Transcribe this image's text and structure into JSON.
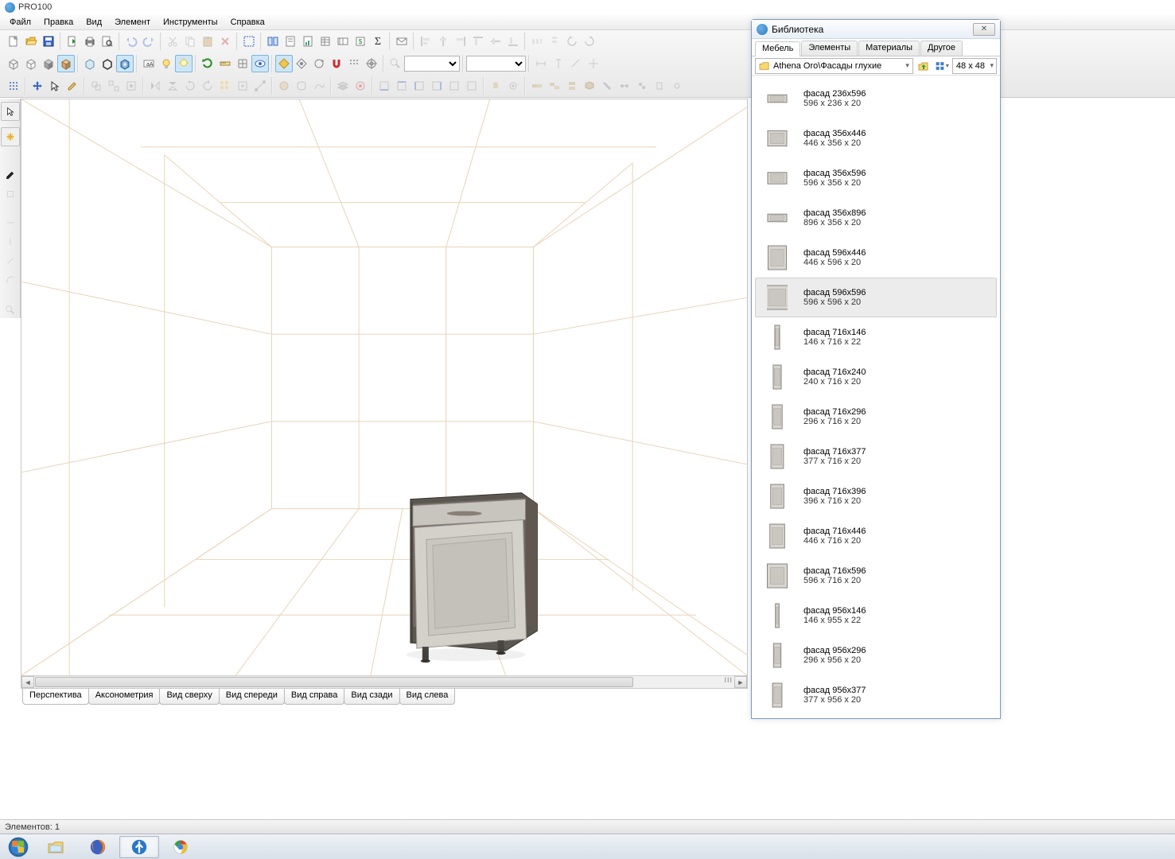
{
  "title": "PRO100",
  "menu": [
    "Файл",
    "Правка",
    "Вид",
    "Элемент",
    "Инструменты",
    "Справка"
  ],
  "view_tabs": [
    "Перспектива",
    "Аксонометрия",
    "Вид сверху",
    "Вид спереди",
    "Вид справа",
    "Вид сзади",
    "Вид слева"
  ],
  "active_view_tab": 0,
  "status": "Элементов: 1",
  "library": {
    "title": "Библиотека",
    "tabs": [
      "Мебель",
      "Элементы",
      "Материалы",
      "Другое"
    ],
    "active_tab": 0,
    "path": "Athena Oro\\Фасады глухие",
    "size_label": "48 x  48",
    "items": [
      {
        "name": "фасад 236x596",
        "dim": "596 x 236 x 20",
        "thumb_ratio": 0.4,
        "selected": false
      },
      {
        "name": "фасад 356x446",
        "dim": "446 x 356 x 20",
        "thumb_ratio": 0.8,
        "selected": false
      },
      {
        "name": "фасад 356x596",
        "dim": "596 x 356 x 20",
        "thumb_ratio": 0.6,
        "selected": false
      },
      {
        "name": "фасад 356x896",
        "dim": "896 x 356 x 20",
        "thumb_ratio": 0.4,
        "selected": false
      },
      {
        "name": "фасад 596x446",
        "dim": "446 x 596 x 20",
        "thumb_ratio": 1.3,
        "selected": false
      },
      {
        "name": "фасад 596x596",
        "dim": "596 x 596 x 20",
        "thumb_ratio": 1.0,
        "selected": true
      },
      {
        "name": "фасад 716x146",
        "dim": "146 x 716 x 22",
        "thumb_ratio": 4.9,
        "selected": false
      },
      {
        "name": "фасад 716x240",
        "dim": "240 x 716 x 20",
        "thumb_ratio": 2.98,
        "selected": false
      },
      {
        "name": "фасад 716x296",
        "dim": "296 x 716 x 20",
        "thumb_ratio": 2.42,
        "selected": false
      },
      {
        "name": "фасад 716x377",
        "dim": "377 x 716 x 20",
        "thumb_ratio": 1.9,
        "selected": false
      },
      {
        "name": "фасад 716x396",
        "dim": "396 x 716 x 20",
        "thumb_ratio": 1.81,
        "selected": false
      },
      {
        "name": "фасад 716x446",
        "dim": "446 x 716 x 20",
        "thumb_ratio": 1.61,
        "selected": false
      },
      {
        "name": "фасад 716x596",
        "dim": "596 x 716 x 20",
        "thumb_ratio": 1.2,
        "selected": false
      },
      {
        "name": "фасад 956x146",
        "dim": "146 x 955 x 22",
        "thumb_ratio": 6.5,
        "selected": false
      },
      {
        "name": "фасад 956x296",
        "dim": "296 x 956 x 20",
        "thumb_ratio": 3.23,
        "selected": false
      },
      {
        "name": "фасад 956x377",
        "dim": "377 x 956 x 20",
        "thumb_ratio": 2.54,
        "selected": false
      }
    ]
  },
  "scroll_marker": "III"
}
